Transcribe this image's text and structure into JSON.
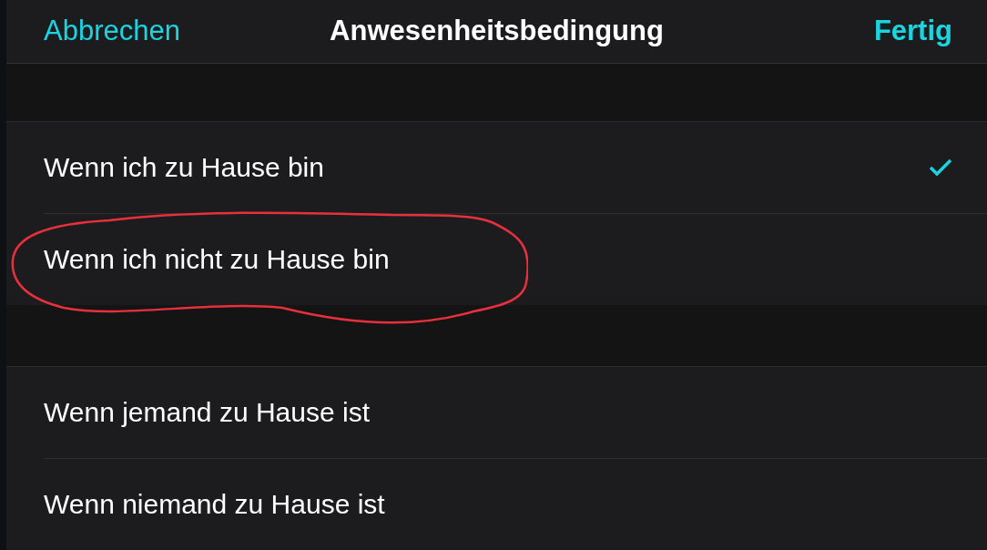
{
  "nav_bar": {
    "cancel": "Abbrechen",
    "title": "Anwesenheitsbedingung",
    "done": "Fertig"
  },
  "sections": [
    {
      "rows": [
        {
          "label": "Wenn ich zu Hause bin",
          "selected": true,
          "highlighted": false
        },
        {
          "label": "Wenn ich nicht zu Hause bin",
          "selected": false,
          "highlighted": true
        }
      ]
    },
    {
      "rows": [
        {
          "label": "Wenn jemand zu Hause ist",
          "selected": false,
          "highlighted": false
        },
        {
          "label": "Wenn niemand zu Hause ist",
          "selected": false,
          "highlighted": false
        }
      ]
    }
  ]
}
